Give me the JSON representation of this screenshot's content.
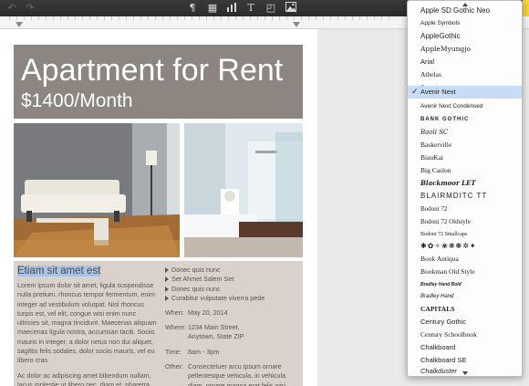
{
  "toolbar": {
    "buttons": [
      {
        "name": "undo-icon",
        "glyph": "↶"
      },
      {
        "name": "redo-icon",
        "glyph": "↷"
      },
      {
        "name": "paragraph-icon",
        "glyph": "¶"
      },
      {
        "name": "table-icon",
        "glyph": "▦"
      },
      {
        "name": "chart-icon",
        "glyph": "▮"
      },
      {
        "name": "text-icon",
        "glyph": "T"
      },
      {
        "name": "shape-icon",
        "glyph": "◰"
      },
      {
        "name": "media-icon",
        "glyph": "▣"
      }
    ]
  },
  "flyer": {
    "title": "Apartment for Rent",
    "price": "$1400/Month",
    "heading": "Etiam sit amet est",
    "paragraph1": "Lorem ipsum dolor sit amet, ligula suspendisse nulla pretium, rhoncus tempor fermentum, enim integer ad vestibulum volutpat. Nisl rhoncus turpis est, vel elit, congue wisi enim nunc ultricies sit, magna tincidunt. Maecenas aliquam maecenas ligula nostra, accumsan taciti. Sociis mauris in integer, a dolor netus non dui aliquet, sagittis felis sodales, dolor sociis mauris, vel eu libero cras.",
    "paragraph2": "Ac dolor ac adipiscing amet bibendum nullam, lacus molestie ut libero nec, diam et, pharetra",
    "bullets": [
      "Donec quis nunc",
      "Set Ahmet Salem Set",
      "Donec quis nunc",
      "Curabitur vulputate viverra pede"
    ],
    "when1_label": "When:",
    "when1_value": "May 20, 2014",
    "where_label": "Where:",
    "where_value_line1": "1234 Main Street,",
    "where_value_line2": "Anytown, State ZIP",
    "time_label": "Time:",
    "time_value": "8am - 3pm",
    "other_label": "Other:",
    "other_value": "Consectetuer arcu ipsum ornare pellentesque vehicula, in vehicula diam, ornare magna erat felis wisi."
  },
  "font_menu": {
    "selected": "Avenir Next",
    "items": [
      "Apple SD Gothic Neo",
      "Apple Symbols",
      "AppleGothic",
      "AppleMyungjo",
      "Arial",
      "Athelas",
      "Avenir",
      "Avenir Next",
      "Avenir Next Condensed",
      "Bank Gothic",
      "Baoli SC",
      "Baskerville",
      "BiauKai",
      "Big Caslon",
      "Blackmoor LET",
      "BLAIRMDITC TT",
      "Bodoni 72",
      "Bodoni 72 Oldstyle",
      "Bodoni 72 Smallcaps",
      "Bodoni Ornaments",
      "Book Antiqua",
      "Bookman Old Style",
      "Bradley Hand Bold",
      "Bradley Hand",
      "Capitals",
      "Century Gothic",
      "Century Schoolbook",
      "Chalkboard",
      "Chalkboard SE",
      "Chalkduster"
    ],
    "ornaments_sample": "✱✿✧❀❋❃✲✦"
  },
  "colors": {
    "banner": "#8d8580",
    "info_box": "#d9d1ca",
    "selection": "#a9c2e5",
    "menu_selected": "#c8dcf7"
  }
}
